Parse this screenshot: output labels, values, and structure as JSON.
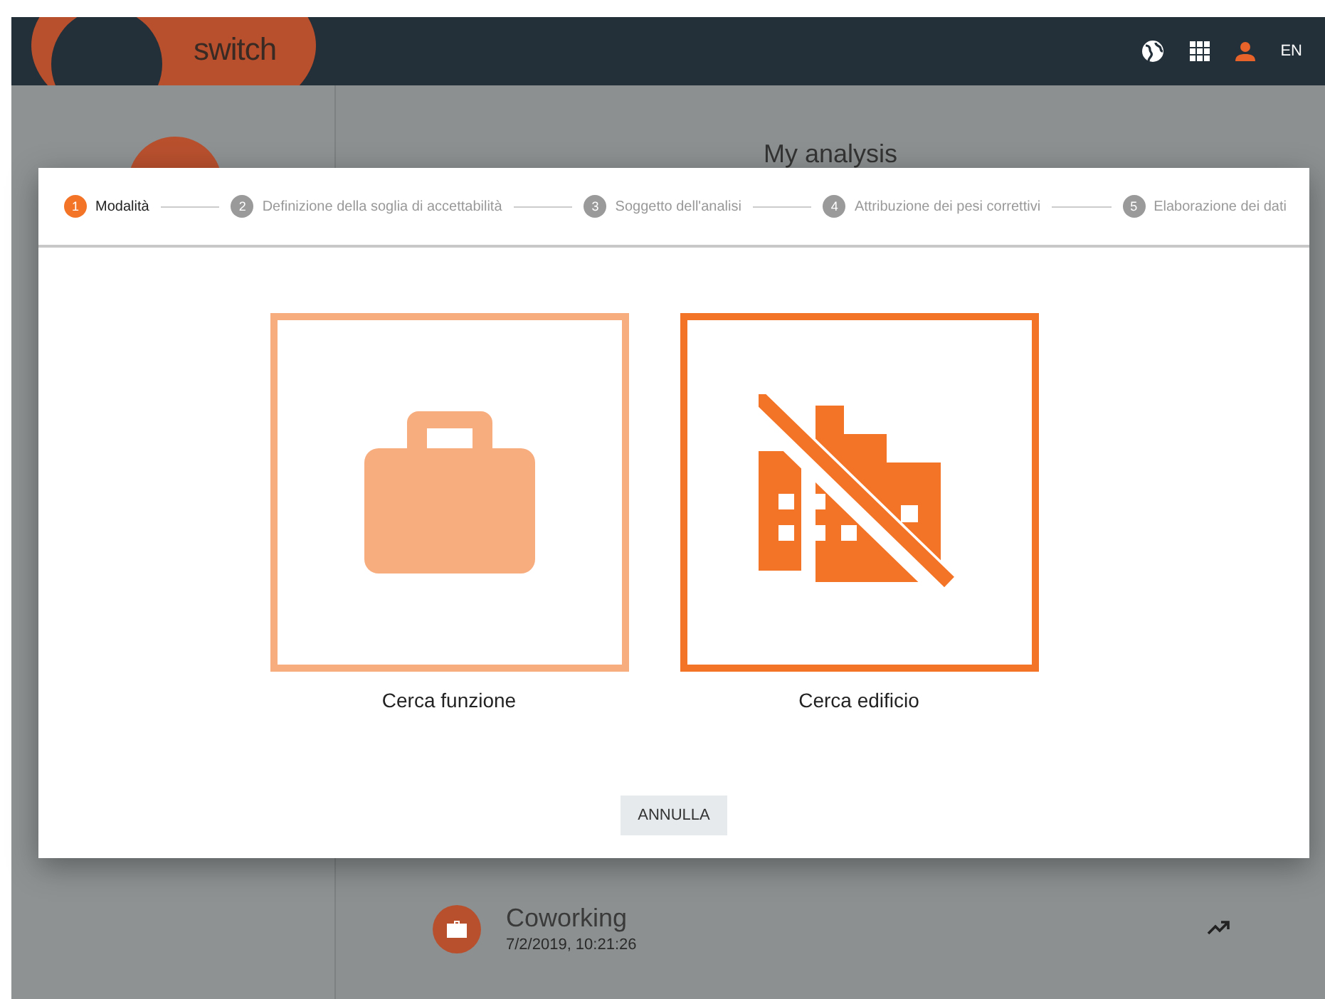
{
  "header": {
    "logo": "switch",
    "language": "EN"
  },
  "page": {
    "title": "My analysis",
    "items": [
      {
        "name": "Coworking",
        "date": "7/2/2019, 10:21:26"
      }
    ]
  },
  "dialog": {
    "steps": [
      {
        "number": "1",
        "label": "Modalità",
        "selected": true
      },
      {
        "number": "2",
        "label": "Definizione della soglia di accettabilità",
        "selected": false
      },
      {
        "number": "3",
        "label": "Soggetto dell'analisi",
        "selected": false
      },
      {
        "number": "4",
        "label": "Attribuzione dei pesi correttivi",
        "selected": false
      },
      {
        "number": "5",
        "label": "Elaborazione dei dati",
        "selected": false
      }
    ],
    "options": [
      {
        "kind": "briefcase",
        "label": "Cerca funzione",
        "selected": false
      },
      {
        "kind": "building-off",
        "label": "Cerca edificio",
        "selected": true
      }
    ],
    "cancel": "ANNULLA"
  }
}
